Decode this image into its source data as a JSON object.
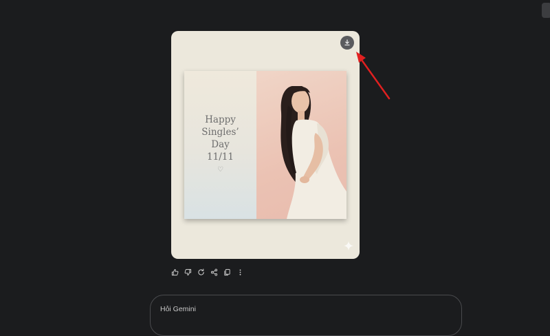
{
  "image_card": {
    "poster_lines": [
      "Happy",
      "Singles’",
      "Day",
      "11/11"
    ],
    "poster_heart_icon": "heart-outline-icon",
    "download_icon": "download-icon",
    "watermark_icon": "gemini-sparkle-icon"
  },
  "actions": [
    {
      "name": "thumbs-up",
      "icon": "thumbs-up-icon"
    },
    {
      "name": "thumbs-down",
      "icon": "thumbs-down-icon"
    },
    {
      "name": "regenerate",
      "icon": "refresh-icon"
    },
    {
      "name": "share",
      "icon": "share-icon"
    },
    {
      "name": "copy",
      "icon": "copy-icon"
    },
    {
      "name": "more",
      "icon": "more-vertical-icon"
    }
  ],
  "input": {
    "placeholder": "Hỏi Gemini"
  },
  "annotation": {
    "color": "#e02020"
  },
  "colors": {
    "background": "#1b1c1e",
    "card": "#ece8dc"
  }
}
